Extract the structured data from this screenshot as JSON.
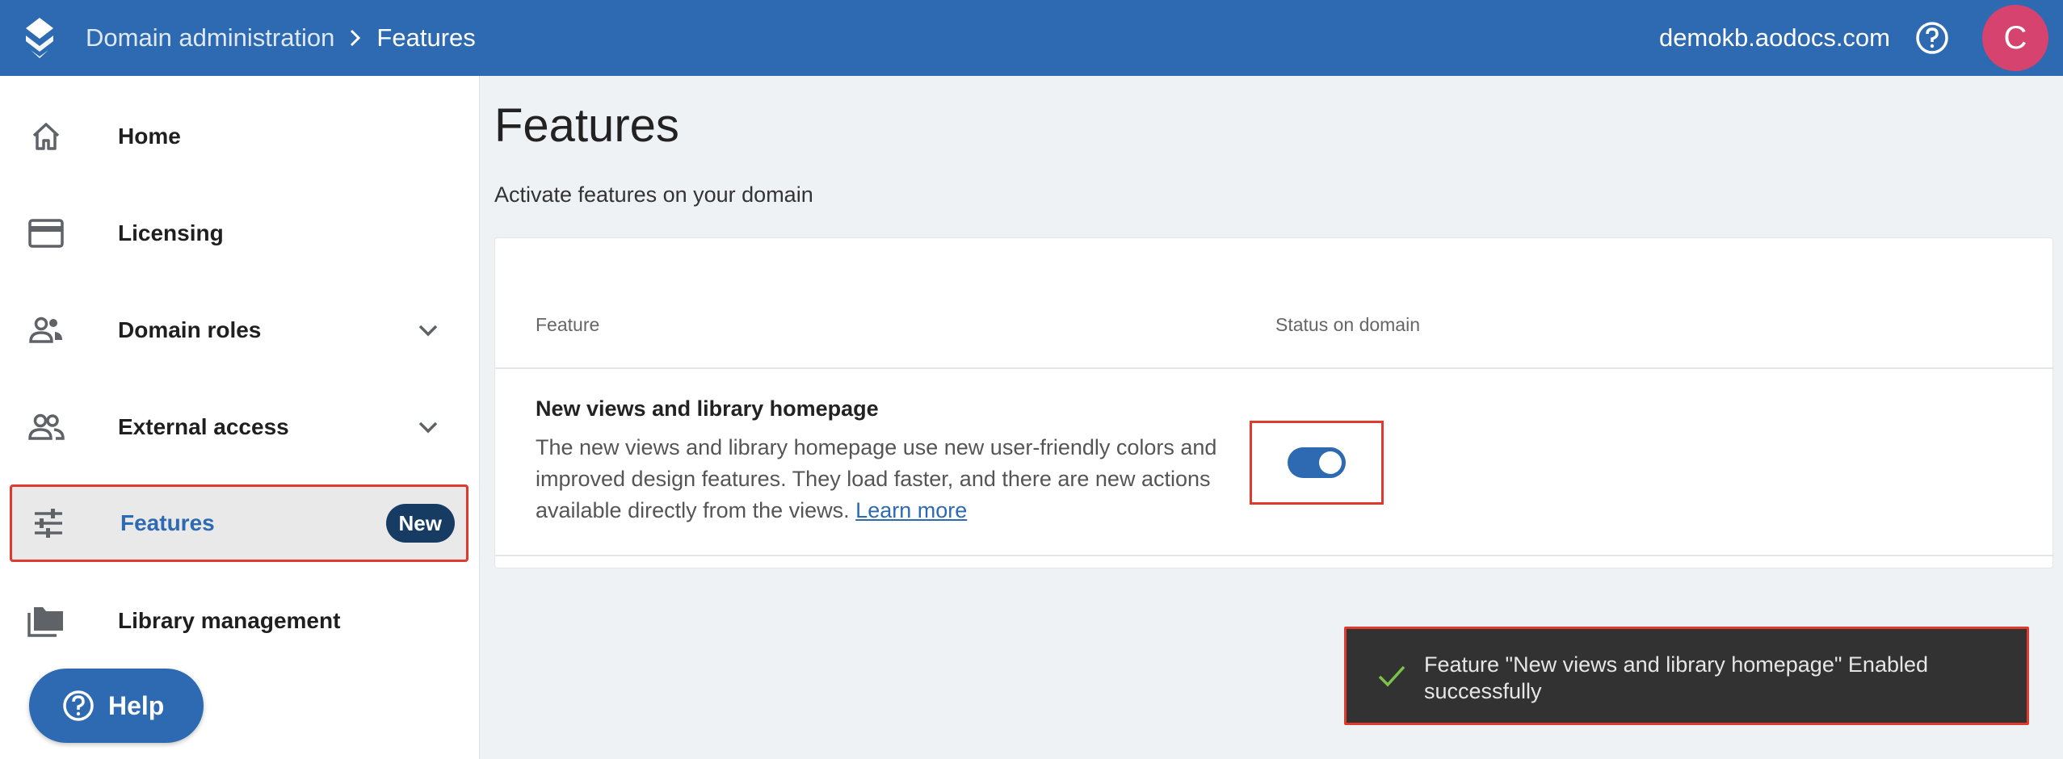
{
  "header": {
    "breadcrumb_root": "Domain administration",
    "breadcrumb_current": "Features",
    "domain": "demokb.aodocs.com",
    "avatar_initial": "C"
  },
  "sidebar": {
    "items": [
      {
        "label": "Home",
        "icon": "home-icon"
      },
      {
        "label": "Licensing",
        "icon": "credit-card-icon"
      },
      {
        "label": "Domain roles",
        "icon": "people-icon",
        "expandable": true
      },
      {
        "label": "External access",
        "icon": "group-icon",
        "expandable": true
      },
      {
        "label": "Features",
        "icon": "tune-icon",
        "active": true,
        "badge": "New"
      },
      {
        "label": "Library management",
        "icon": "folders-icon"
      }
    ],
    "help_label": "Help"
  },
  "main": {
    "title": "Features",
    "subtitle": "Activate features on your domain",
    "table": {
      "col_feature": "Feature",
      "col_status": "Status on domain",
      "rows": [
        {
          "title": "New views and library homepage",
          "description": "The new views and library homepage use new user-friendly colors and improved design features. They load faster, and there are new actions available directly from the views.",
          "link": "Learn more",
          "enabled": true
        }
      ]
    }
  },
  "toast": {
    "message": "Feature \"New views and library homepage\" Enabled successfully"
  },
  "colors": {
    "brand": "#2d6ab1",
    "highlight": "#e03a2e",
    "badge": "#163c63",
    "avatar": "#d6436e",
    "toast_bg": "#323232",
    "success": "#7cc34a"
  }
}
